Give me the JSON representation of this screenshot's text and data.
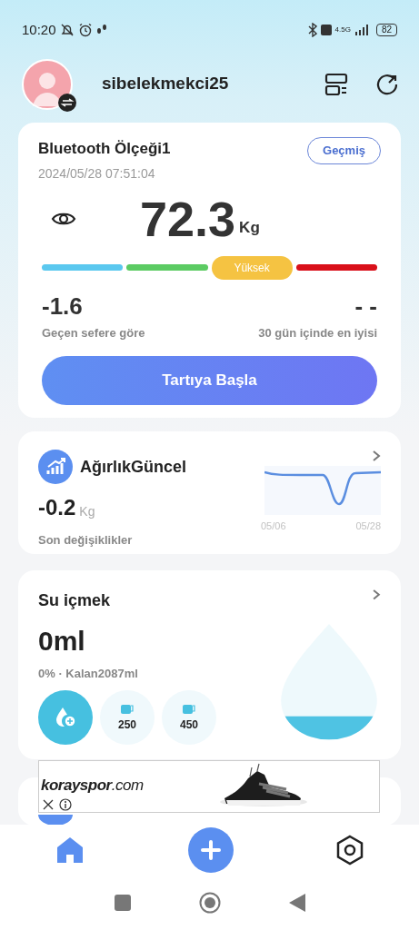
{
  "status_bar": {
    "time": "10:20",
    "network": "4.5G",
    "battery": "82"
  },
  "profile": {
    "username": "sibelekmekci25"
  },
  "scale_card": {
    "device": "Bluetooth Ölçeği1",
    "history_button": "Geçmiş",
    "timestamp": "2024/05/28 07:51:04",
    "weight": "72.3",
    "unit": "Kg",
    "segments": [
      {
        "color": "#5bc8ef",
        "selected": false
      },
      {
        "color": "#5ccb63",
        "selected": false
      },
      {
        "color": "#f5c342",
        "selected": true,
        "label": "Yüksek"
      },
      {
        "color": "#d9101a",
        "selected": false
      }
    ],
    "change_value": "-1.6",
    "change_label": "Geçen sefere göre",
    "best_value": "- -",
    "best_label": "30 gün içinde en iyisi",
    "start_button": "Tartıya Başla"
  },
  "trend_card": {
    "title": "AğırlıkGüncel",
    "value": "-0.2",
    "unit": "Kg",
    "caption": "Son değişiklikler",
    "x_start": "05/06",
    "x_end": "05/28"
  },
  "water_card": {
    "title": "Su içmek",
    "amount": "0ml",
    "summary": "0% · Kalan2087ml",
    "cups": [
      {
        "kind": "add"
      },
      {
        "kind": "cup",
        "label": "250"
      },
      {
        "kind": "cup",
        "label": "450"
      }
    ]
  },
  "ad": {
    "brand": "**korayspor**.com"
  },
  "bottom_nav": [
    {
      "kind": "home",
      "selected": true
    },
    {
      "kind": "add"
    },
    {
      "kind": "settings",
      "selected": false
    }
  ]
}
